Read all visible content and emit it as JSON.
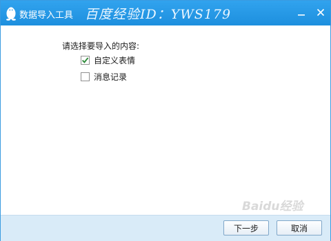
{
  "window": {
    "title": "数据导入工具",
    "watermark_id": "百度经验ID：YWS179",
    "icons": {
      "app": "qq-penguin-icon",
      "minimize": "minimize-icon",
      "close": "close-icon"
    }
  },
  "content": {
    "prompt": "请选择要导入的内容:",
    "options": [
      {
        "label": "自定义表情",
        "checked": true
      },
      {
        "label": "消息记录",
        "checked": false
      }
    ]
  },
  "footer": {
    "next_label": "下一步",
    "cancel_label": "取消"
  },
  "watermark_bottom": "Baidu经验",
  "colors": {
    "titlebar": "#1d8fde",
    "footer": "#d9ebf8",
    "check": "#2e8b3a"
  }
}
